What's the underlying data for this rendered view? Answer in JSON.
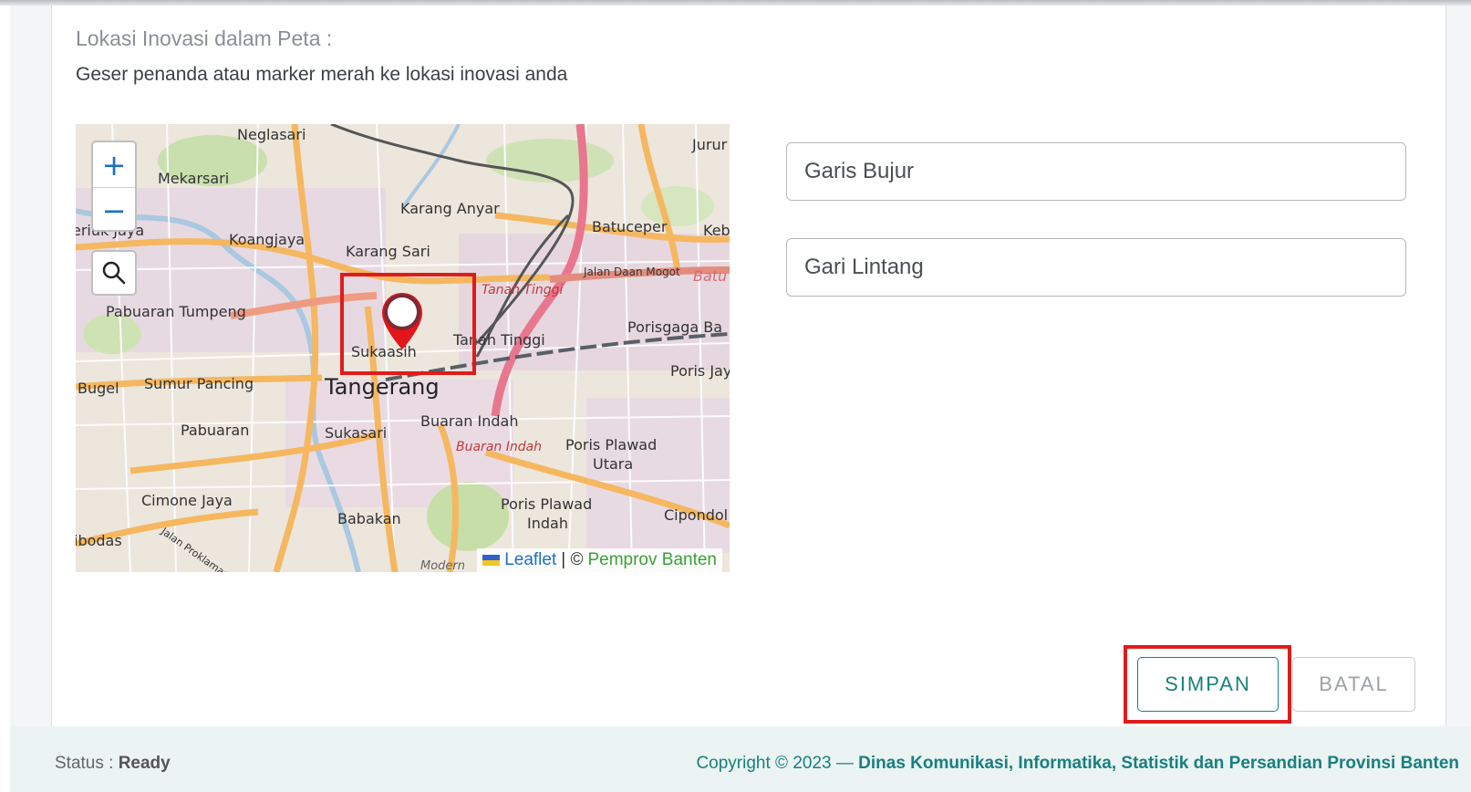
{
  "section": {
    "title": "Lokasi Inovasi dalam Peta :",
    "subtitle": "Geser penanda atau marker merah ke lokasi inovasi anda"
  },
  "map": {
    "zoom_in": "+",
    "zoom_out": "−",
    "labels": {
      "neglasari": "Neglasari",
      "jurur": "Jurur",
      "mekarsari": "Mekarsari",
      "karang_anyar": "Karang Anyar",
      "batuceper": "Batuceper",
      "keb": "Keb",
      "periuk_jaya": "eriuk Jaya",
      "koangjaya": "Koangjaya",
      "karang_sari": "Karang Sari",
      "jalan_daan_mogot": "Jalan Daan Mogot",
      "batu": "Batu",
      "tanah_tinggi_station": "Tanah Tinggi",
      "pabuaran_tumpeng": "Pabuaran Tumpeng",
      "tanah_tinggi": "Tanah Tinggi",
      "porisgaga": "Porisgaga Ba",
      "sukaasih": "Sukaasih",
      "bugel": "Bugel",
      "sumur_pancing": "Sumur Pancing",
      "tangerang": "Tangerang",
      "poris_jaya": "Poris Jay",
      "pabuaran": "Pabuaran",
      "sukasari": "Sukasari",
      "buaran_indah": "Buaran Indah",
      "buaran_indah_station": "Buaran Indah",
      "poris_plawad_utara_1": "Poris Plawad",
      "poris_plawad_utara_2": "Utara",
      "cimone_jaya": "Cimone Jaya",
      "babakan": "Babakan",
      "poris_plawad_indah_1": "Poris Plawad",
      "poris_plawad_indah_2": "Indah",
      "cipondoh": "Cipondol",
      "cibodas": "ibodas",
      "jalan_proklamasi": "Jalan Proklamasi",
      "modern": "Modern"
    },
    "attribution": {
      "leaflet": "Leaflet",
      "separator": "| ©",
      "provider": "Pemprov Banten"
    },
    "flag_colors": [
      "#2f5fd0",
      "#f3c623"
    ]
  },
  "form": {
    "longitude_placeholder": "Garis Bujur",
    "longitude_value": "",
    "latitude_placeholder": "Gari Lintang",
    "latitude_value": ""
  },
  "buttons": {
    "save": "SIMPAN",
    "cancel": "BATAL"
  },
  "footer": {
    "status_label": "Status :",
    "status_value": "Ready",
    "copyright_prefix": "Copyright © 2023 —",
    "organization": "Dinas Komunikasi, Informatika, Statistik dan Persandian Provinsi Banten"
  },
  "colors": {
    "accent": "#17817f",
    "highlight": "#e11b1b",
    "marker": "#e5141c"
  }
}
